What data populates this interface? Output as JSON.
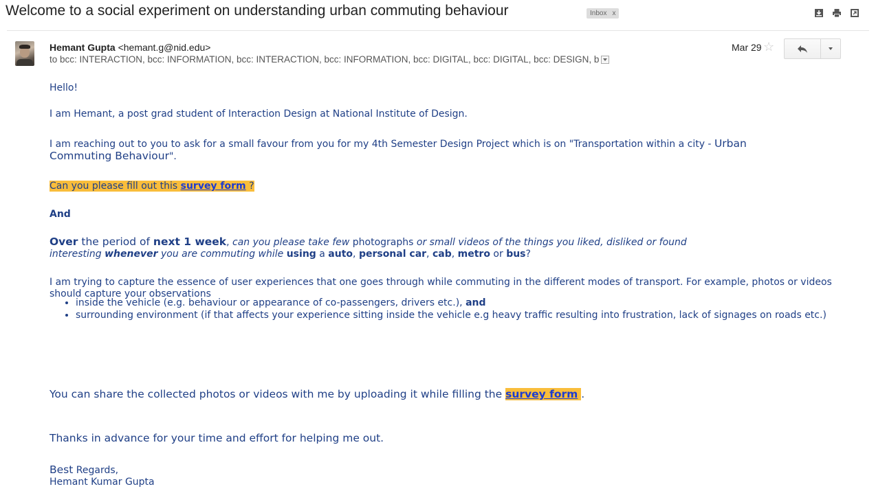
{
  "subject": "Welcome to a social experiment on understanding urban commuting behaviour",
  "label": {
    "text": "Inbox",
    "close": "x"
  },
  "toolbar_icons": [
    "download-icon",
    "print-icon",
    "new-window-icon"
  ],
  "sender": {
    "name": "Hemant Gupta",
    "email": "<hemant.g@nid.edu>"
  },
  "recipients": "to bcc: INTERACTION, bcc: INFORMATION, bcc: INTERACTION, bcc: INFORMATION, bcc: DIGITAL, bcc: DIGITAL, bcc: DESIGN, b",
  "date": "Mar 29",
  "colors": {
    "body_text": "#1f3f86",
    "link": "#1c3bd1",
    "highlight": "#f9bd3b"
  },
  "message": {
    "greeting": "Hello!",
    "intro": "I am Hemant, a post grad student of Interaction Design at National Institute of Design.",
    "request_a": "I am reaching out to you to ask for a small favour from you for my 4th Semester Design Project which is on \"Transportation within a city - ",
    "request_b": "Urban",
    "request_c": "Commuting Behaviour",
    "request_d": "\".",
    "survey_prompt": "Can you please fill out this ",
    "survey_link": "survey form",
    "survey_end": " ?",
    "and": "And",
    "p_over": "Over",
    "p_the_period": " the period of ",
    "p_next_week": "next 1 week",
    "p_comma": ", ",
    "p_can_you": "can you please take few ",
    "p_photographs": "photographs",
    "p_or_small": " or small videos of the things you liked, disliked or  found",
    "p_interesting": "interesting ",
    "p_whenever": "whenever",
    "p_you_are": " you are commuting while ",
    "p_using": "using",
    "p_a": " a ",
    "p_auto": "auto",
    "p_c1": ", ",
    "p_car": "personal car",
    "p_c2": ", ",
    "p_cab": "cab",
    "p_c3": ", ",
    "p_metro": "metro",
    "p_or": " or ",
    "p_bus": "bus",
    "p_q": "?",
    "capture": "I am trying to capture the essence of user experiences that one goes through while commuting in the different modes of transport. For example, photos or videos should capture your observations",
    "bullet1": "inside the vehicle (e.g. behaviour or appearance of co-passengers, drivers etc.), ",
    "bullet1_and": "and",
    "bullet2": "surrounding environment (if that affects your experience sitting inside the vehicle e.g heavy traffic resulting into frustration, lack of signages on roads etc.)",
    "share": "You can share the collected photos or videos with me by uploading it while filling the ",
    "share_link": "survey form",
    "share_end": ".",
    "thanks": "Thanks in advance for your time and effort for helping me out.",
    "best": "Best",
    "regards": " Regards,",
    "signature": "Hemant Kumar Gupta"
  }
}
